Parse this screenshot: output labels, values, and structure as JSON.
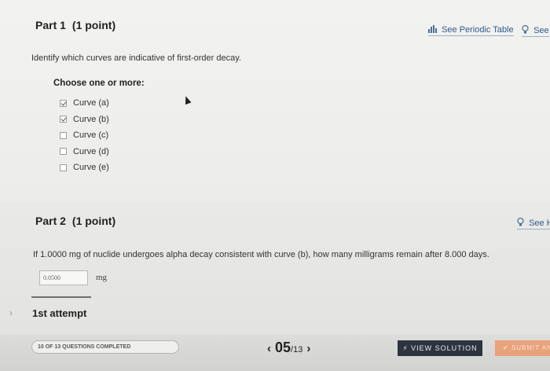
{
  "part1": {
    "title": "Part 1",
    "points": "(1 point)",
    "periodic_table_icon": "bar-chart-icon",
    "periodic_table_label": "See Periodic Table",
    "hint_icon": "lightbulb-icon",
    "hint_label": "See",
    "question": "Identify which curves are indicative of first-order decay.",
    "choose_label": "Choose one or more:",
    "options": [
      {
        "label": "Curve (a)",
        "checked": true
      },
      {
        "label": "Curve (b)",
        "checked": true
      },
      {
        "label": "Curve (c)",
        "checked": false
      },
      {
        "label": "Curve (d)",
        "checked": false
      },
      {
        "label": "Curve (e)",
        "checked": false
      }
    ]
  },
  "part2": {
    "title": "Part 2",
    "points": "(1 point)",
    "hint_icon": "lightbulb-icon",
    "hint_label": "See H",
    "question": "If 1.0000 mg of nuclide undergoes alpha decay consistent with curve (b), how many milligrams remain after 8.000 days.",
    "answer_value": "0.0500",
    "unit": "mg",
    "attempt_label": "1st attempt"
  },
  "footer": {
    "progress_label": "10 OF 13 QUESTIONS COMPLETED",
    "current_page": "05",
    "total_pages": "/13",
    "view_solution_label": "VIEW SOLUTION",
    "submit_label": "SUBMIT AN"
  },
  "colors": {
    "link": "#2e5a8a",
    "solution_button": "#2d3440",
    "submit_button": "#e9a27a"
  }
}
